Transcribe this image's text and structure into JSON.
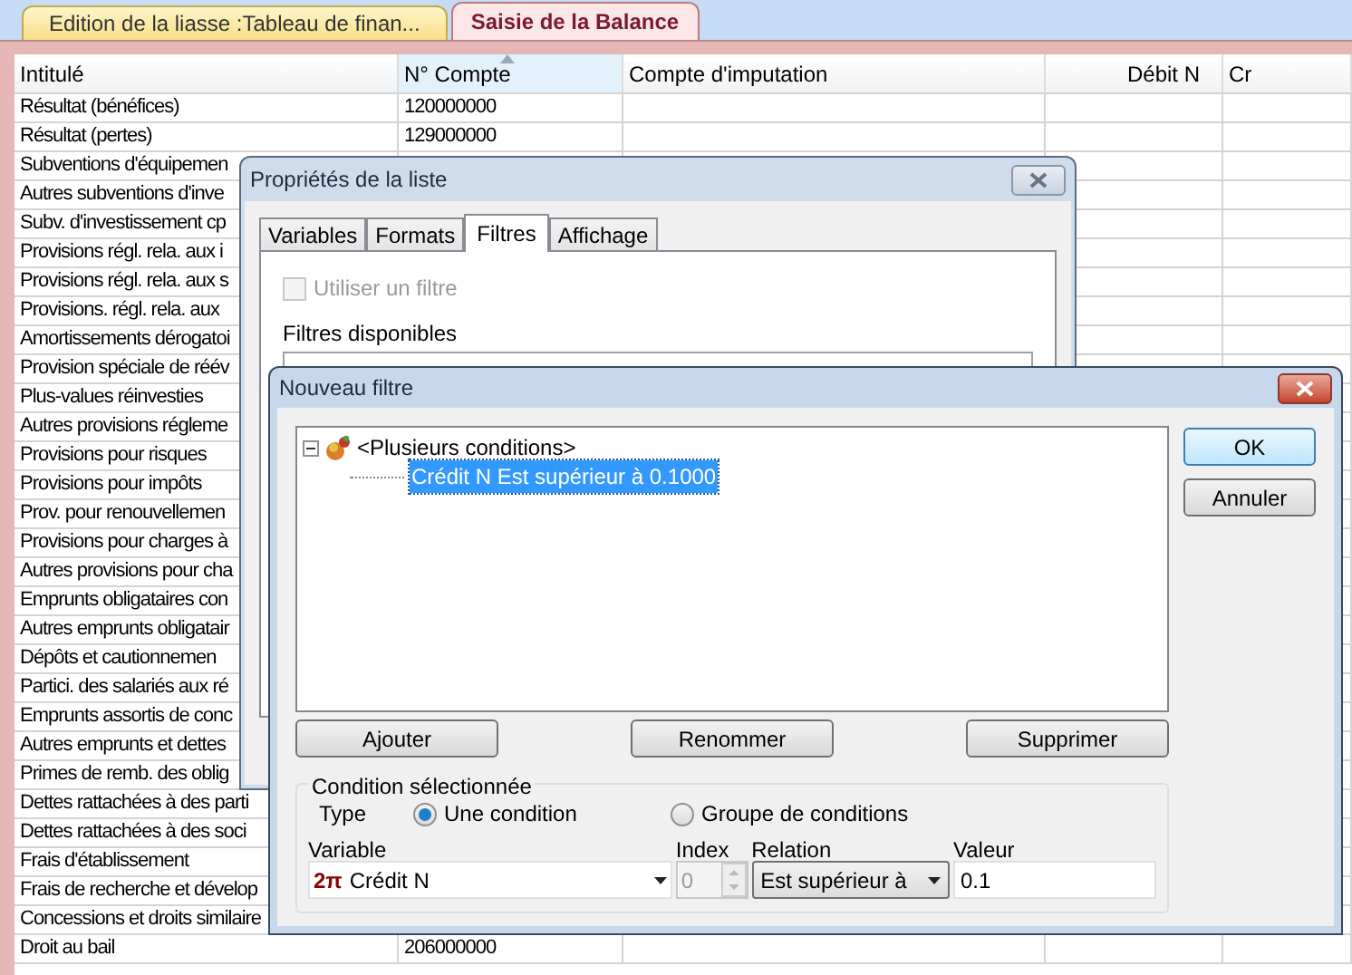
{
  "doc_tabs": [
    {
      "label": "Edition de la liasse :Tableau de finan...",
      "selected": false
    },
    {
      "label": "Saisie de la Balance",
      "selected": true
    }
  ],
  "table": {
    "columns": [
      {
        "label": "Intitulé",
        "sorted": false
      },
      {
        "label": "N° Compte",
        "sorted": true
      },
      {
        "label": "Compte d'imputation",
        "sorted": false
      },
      {
        "label": "Débit N",
        "sorted": false
      },
      {
        "label": "Cr",
        "sorted": false
      }
    ],
    "rows": [
      {
        "label": "Résultat (bénéfices)",
        "account": "120000000"
      },
      {
        "label": "Résultat (pertes)",
        "account": "129000000"
      },
      {
        "label": "Subventions d'équipemen"
      },
      {
        "label": "Autres subventions d'inve"
      },
      {
        "label": "Subv. d'investissement cp"
      },
      {
        "label": "Provisions régl. rela. aux i"
      },
      {
        "label": "Provisions régl. rela. aux s"
      },
      {
        "label": "Provisions. régl. rela. aux"
      },
      {
        "label": "Amortissements dérogatoi"
      },
      {
        "label": "Provision spéciale de réév"
      },
      {
        "label": "Plus-values réinvesties"
      },
      {
        "label": "Autres provisions régleme"
      },
      {
        "label": "Provisions pour risques"
      },
      {
        "label": "Provisions pour impôts"
      },
      {
        "label": "Prov. pour renouvellemen"
      },
      {
        "label": "Provisions pour charges à"
      },
      {
        "label": "Autres provisions pour cha"
      },
      {
        "label": "Emprunts obligataires con"
      },
      {
        "label": "Autres emprunts obligatair"
      },
      {
        "label": "Dépôts et cautionnemen"
      },
      {
        "label": "Partici. des salariés aux ré"
      },
      {
        "label": "Emprunts assortis de conc"
      },
      {
        "label": "Autres emprunts et dettes"
      },
      {
        "label": "Primes de remb. des oblig"
      },
      {
        "label": "Dettes rattachées à des parti"
      },
      {
        "label": "Dettes  rattachées à des soci"
      },
      {
        "label": "Frais d'établissement"
      },
      {
        "label": "Frais de recherche et dévelop"
      },
      {
        "label": "Concessions et droits similaire"
      },
      {
        "label": "Droit au bail",
        "account": "206000000"
      }
    ]
  },
  "list_properties": {
    "title": "Propriétés de la liste",
    "tabs": [
      {
        "label": "Variables",
        "selected": false
      },
      {
        "label": "Formats",
        "selected": false
      },
      {
        "label": "Filtres",
        "selected": true
      },
      {
        "label": "Affichage",
        "selected": false
      }
    ],
    "use_filter": {
      "label": "Utiliser un filtre",
      "checked": false,
      "disabled": true
    },
    "filters_label": "Filtres disponibles"
  },
  "new_filter": {
    "title": "Nouveau filtre",
    "tree": [
      {
        "label": "<Plusieurs conditions>",
        "expanded": true,
        "selected": false,
        "children": [
          {
            "label": "Crédit N Est supérieur à 0.1000",
            "selected": true
          }
        ]
      }
    ],
    "buttons": [
      "Ajouter",
      "Renommer",
      "Supprimer"
    ],
    "side_buttons": [
      "OK",
      "Annuler"
    ],
    "condition": {
      "title": "Condition sélectionnée",
      "type_label": "Type",
      "types": [
        {
          "label": "Une condition",
          "selected": true
        },
        {
          "label": "Groupe de conditions",
          "selected": false
        }
      ],
      "variable_label": "Variable",
      "variable_prefix": "2π",
      "variable": "Crédit N",
      "index_label": "Index",
      "index": "0",
      "relation_label": "Relation",
      "relation": "Est supérieur à",
      "value_label": "Valeur",
      "value": "0.1"
    }
  }
}
